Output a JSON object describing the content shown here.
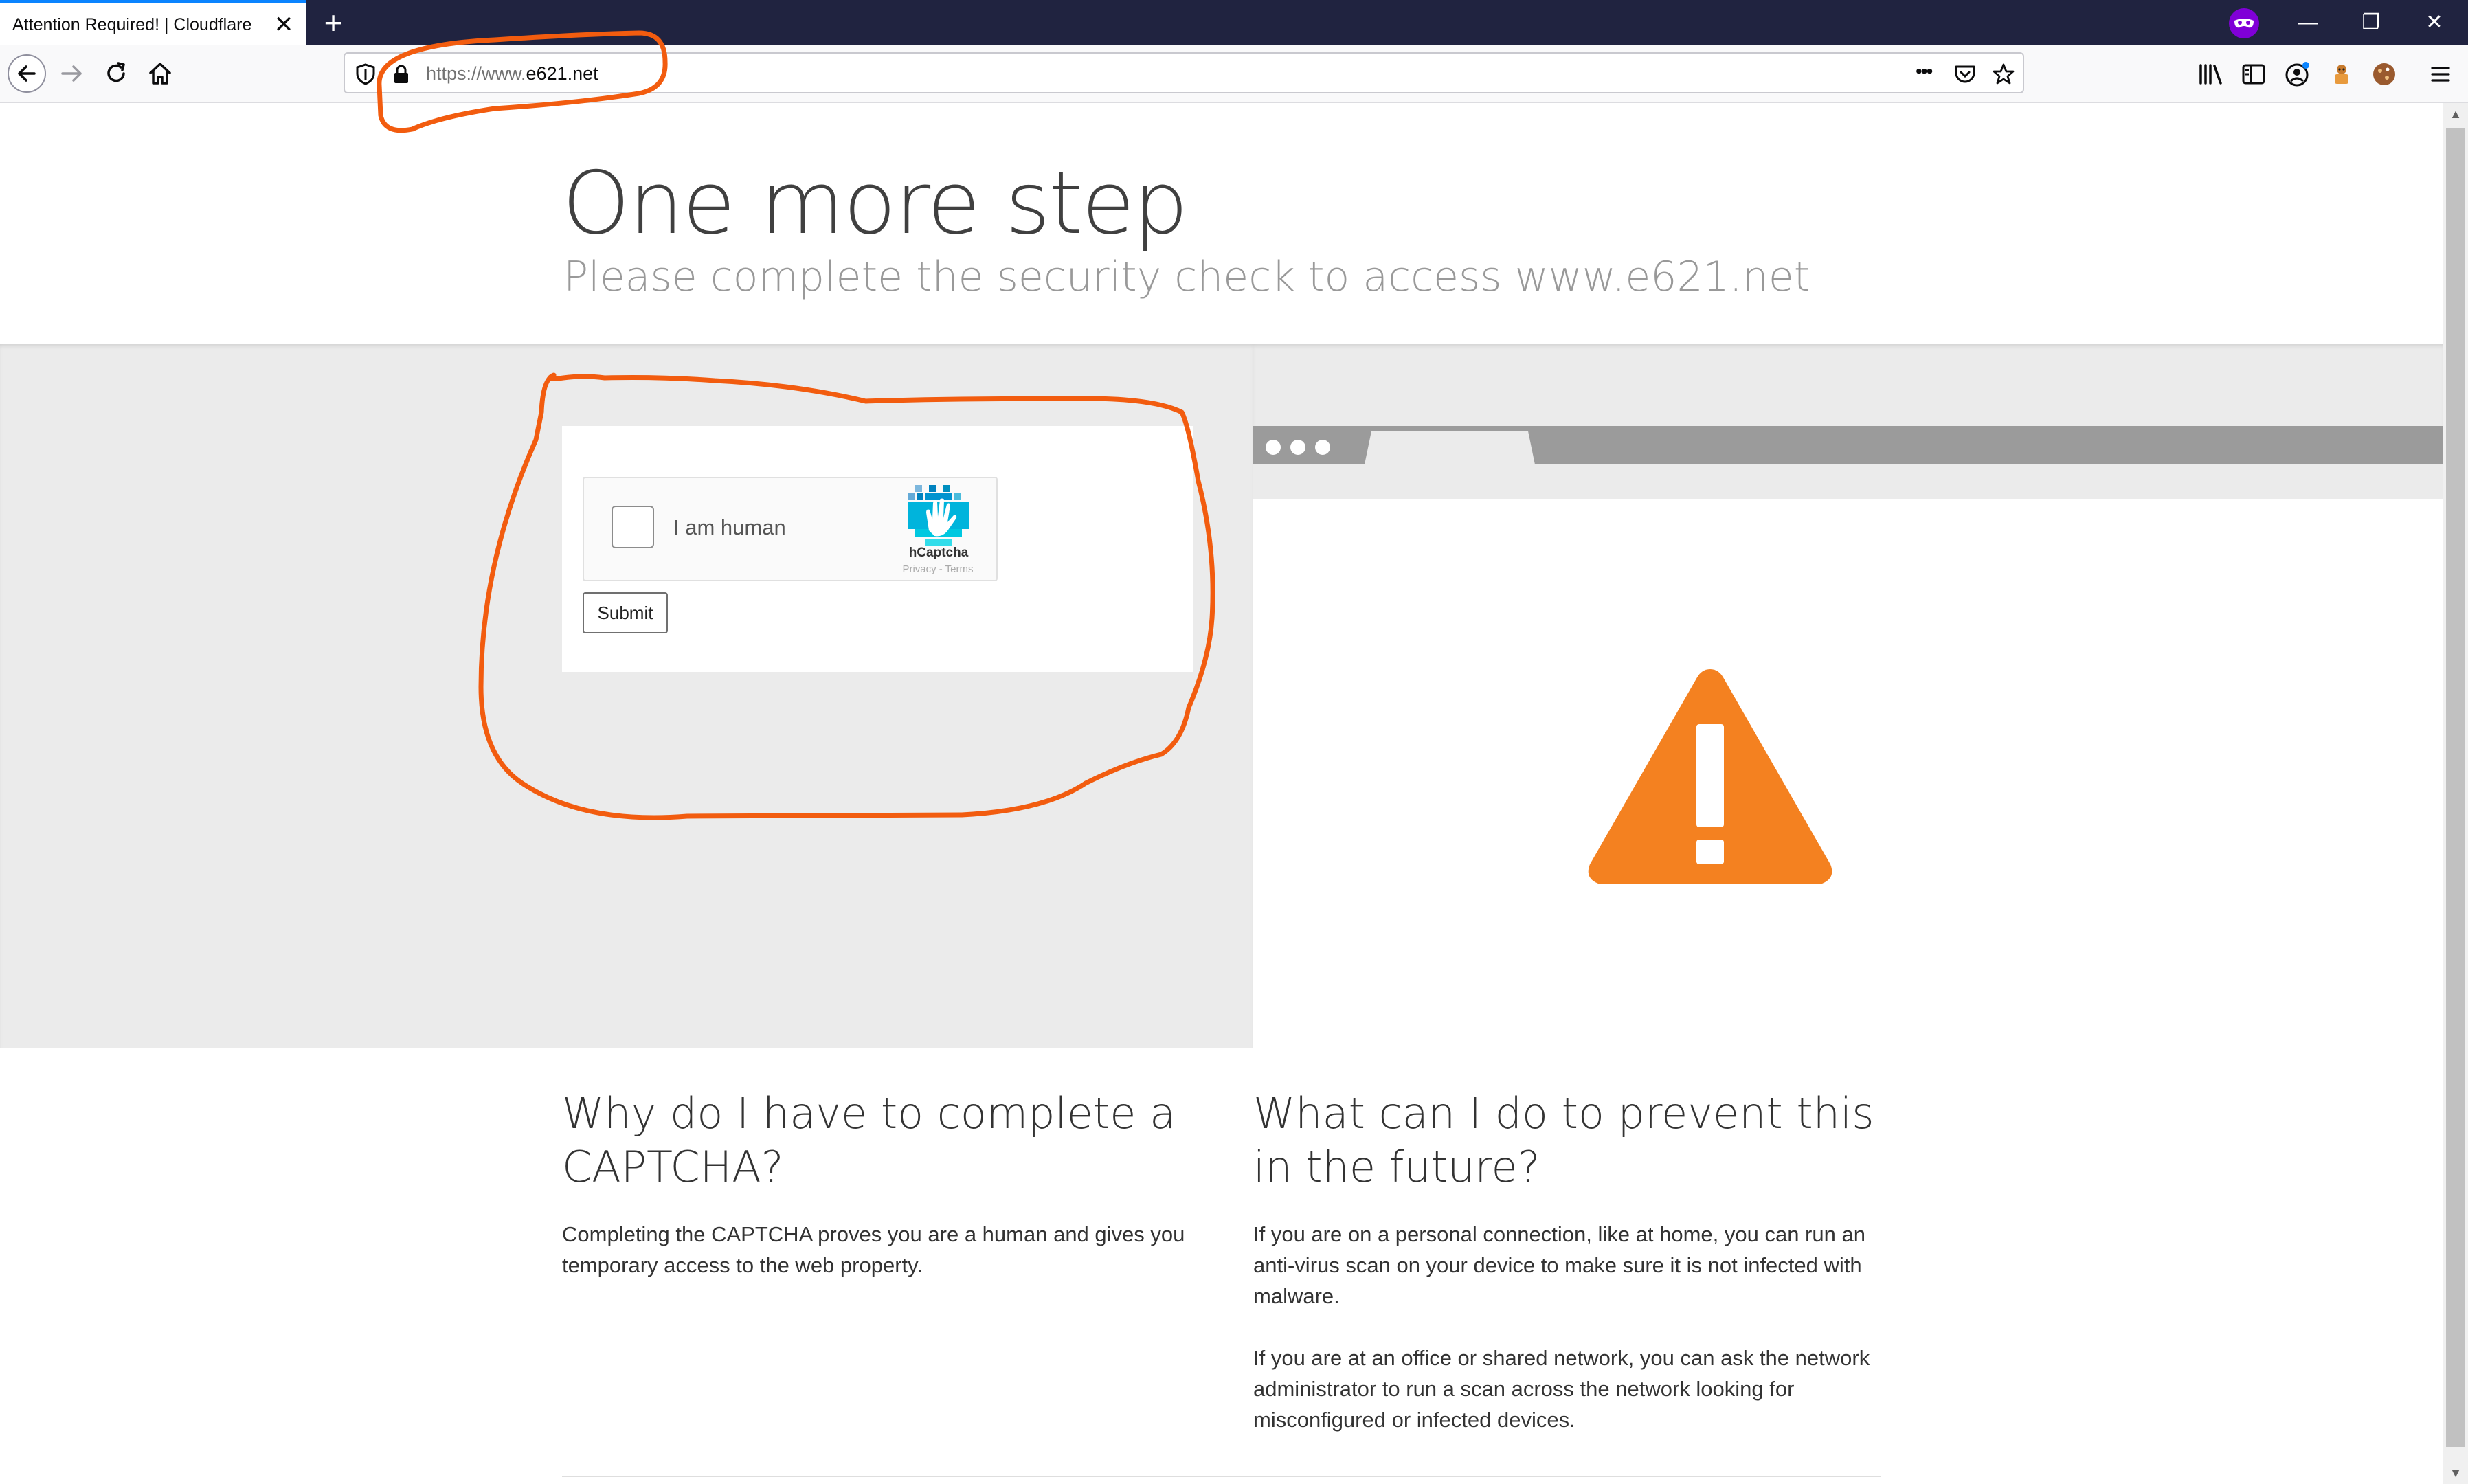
{
  "browser": {
    "tab_title": "Attention Required! | Cloudflare",
    "tab_close": "✕",
    "new_tab": "+",
    "url_scheme": "https://www.",
    "url_host": "e621.net",
    "page_actions": "•••",
    "window_controls": {
      "minimize": "—",
      "restore": "❐",
      "close": "✕"
    },
    "scroll_up": "▲",
    "scroll_down": "▼"
  },
  "page": {
    "title": "One more step",
    "subtitle": "Please complete the security check to access www.e621.net"
  },
  "captcha": {
    "label": "I am human",
    "brand": "hCaptcha",
    "links": "Privacy - Terms",
    "submit_label": "Submit"
  },
  "info": {
    "why_heading": "Why do I have to complete a CAPTCHA?",
    "why_text": "Completing the CAPTCHA proves you are a human and gives you temporary access to the web property.",
    "prevent_heading": "What can I do to prevent this in the future?",
    "prevent_text_1": "If you are on a personal connection, like at home, you can run an anti-virus scan on your device to make sure it is not infected with malware.",
    "prevent_text_2": "If you are at an office or shared network, you can ask the network administrator to run a scan across the network looking for misconfigured or infected devices."
  },
  "colors": {
    "warning": "#f48120",
    "annotation": "#f25c0f",
    "tabbar": "#202340",
    "accent": "#0a84ff"
  },
  "icons": [
    "back-arrow-icon",
    "forward-arrow-icon",
    "reload-icon",
    "home-icon",
    "tracking-shield-icon",
    "lock-icon",
    "pocket-icon",
    "bookmark-star-icon",
    "library-icon",
    "sidebar-icon",
    "account-icon",
    "extension-icon",
    "cookie-icon",
    "menu-icon",
    "private-mask-icon",
    "warning-triangle-icon",
    "hcaptcha-logo-icon"
  ]
}
